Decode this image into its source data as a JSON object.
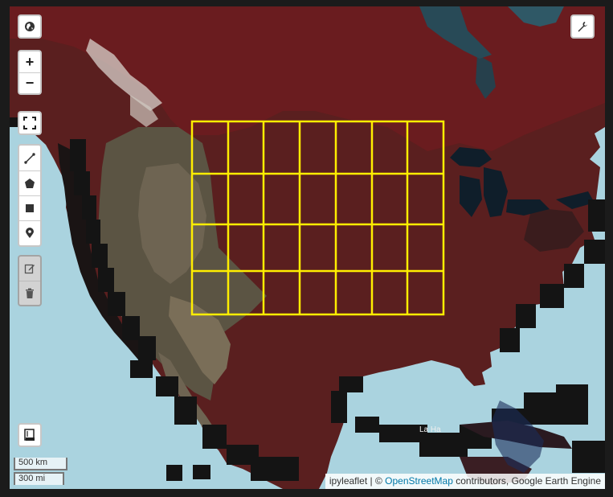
{
  "map": {
    "library": "ipyleaflet",
    "basemap": "Google Earth Engine false-color imagery",
    "grid": {
      "rows": 4,
      "cols": 7,
      "color": "#ffee00"
    }
  },
  "controls": {
    "zoom_in_label": "+",
    "zoom_out_label": "−"
  },
  "scale": {
    "metric": "500 km",
    "imperial": "300 mi"
  },
  "attribution": {
    "prefix": "ipyleaflet",
    "separator": " | © ",
    "osm_link": "OpenStreetMap",
    "suffix": " contributors, Google Earth Engine"
  },
  "labels": {
    "place": "La Ha"
  },
  "icons": [
    "globe-icon",
    "wrench-icon",
    "fullscreen-icon",
    "polyline-icon",
    "polygon-icon",
    "rectangle-icon",
    "marker-icon",
    "edit-icon",
    "trash-icon",
    "layers-icon"
  ]
}
